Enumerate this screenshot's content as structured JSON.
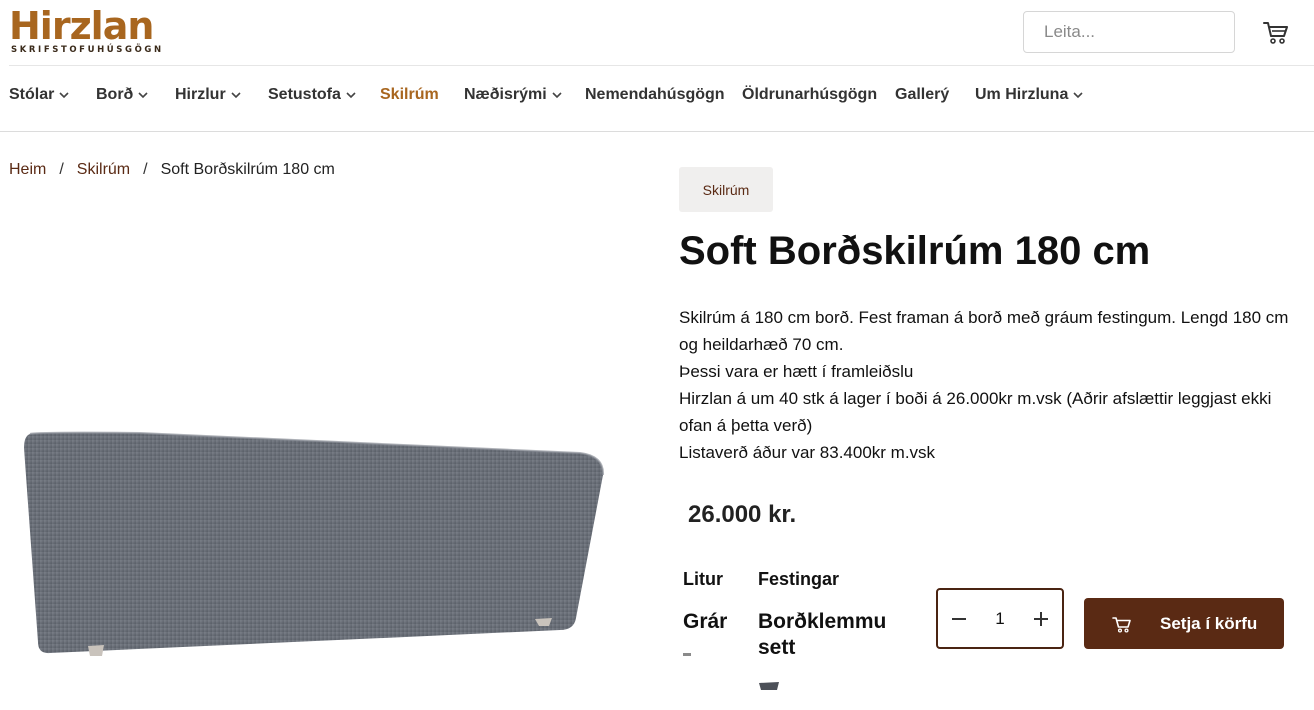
{
  "brand": {
    "name": "Hirzlan",
    "tagline": "SKRIFSTOFUHÚSGÖGN",
    "color": "#a8661f"
  },
  "search": {
    "placeholder": "Leita..."
  },
  "cart": {
    "icon": "cart-icon"
  },
  "nav": [
    {
      "label": "Stólar",
      "dropdown": true,
      "active": false
    },
    {
      "label": "Borð",
      "dropdown": true,
      "active": false
    },
    {
      "label": "Hirzlur",
      "dropdown": true,
      "active": false
    },
    {
      "label": "Setustofa",
      "dropdown": true,
      "active": false
    },
    {
      "label": "Skilrúm",
      "dropdown": false,
      "active": true
    },
    {
      "label": "Næðisrými",
      "dropdown": true,
      "active": false
    },
    {
      "label": "Nemendahúsgögn",
      "dropdown": false,
      "active": false
    },
    {
      "label": "Öldrunarhúsgögn",
      "dropdown": false,
      "active": false
    },
    {
      "label": "Gallerý",
      "dropdown": false,
      "active": false
    },
    {
      "label": "Um Hirzluna",
      "dropdown": true,
      "active": false
    }
  ],
  "breadcrumb": {
    "home": "Heim",
    "sep": "/",
    "category": "Skilrúm",
    "current": "Soft Borðskilrúm 180 cm"
  },
  "product": {
    "category_tag": "Skilrúm",
    "title": "Soft Borðskilrúm 180 cm",
    "description": [
      "Skilrúm á 180 cm borð. Fest framan á borð með gráum festingum. Lengd 180 cm og heildarhæð 70 cm.",
      "Þessi vara er hætt í framleiðslu",
      "Hirzlan á um 40 stk á lager í boði á 26.000kr m.vsk  (Aðrir afslættir leggjast ekki ofan á þetta verð)",
      "Listaverð áður var 83.400kr m.vsk"
    ],
    "price": "26.000 kr.",
    "options": {
      "color_label": "Litur",
      "color_value": "Grár",
      "mount_label": "Festingar",
      "mount_value": "Borðklemmu sett"
    },
    "quantity": "1",
    "add_to_cart": "Setja í körfu"
  },
  "colors": {
    "accent": "#a8661f",
    "primary_dark": "#5a2a14",
    "panel": "#6b7079"
  }
}
